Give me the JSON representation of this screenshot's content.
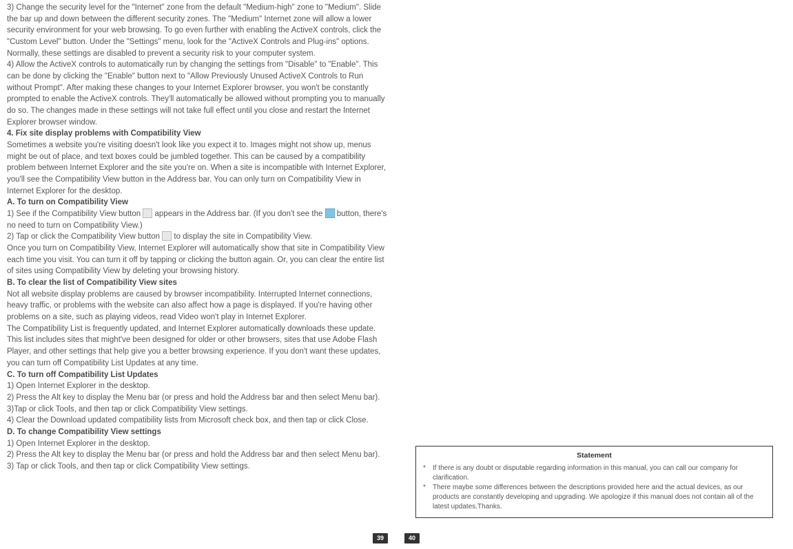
{
  "left": {
    "p3": "3) Change the security level for the \"Internet\" zone from the default \"Medium-high\" zone to \"Medium\". Slide the bar up and down between the different security zones. The \"Medium\" Internet zone will allow a lower security environment for your web browsing. To go even further with enabling the ActiveX controls, click the \"Custom Level\" button. Under the \"Settings\" menu, look for the \"ActiveX Controls and Plug-ins\" options. Normally, these settings are disabled to prevent a security risk to your computer system.",
    "p4": "4) Allow the ActiveX controls to automatically run by changing the settings from \"Disable\" to \"Enable\". This can be done by clicking the \"Enable\" button next to \"Allow Previously Unused ActiveX Controls to Run without Prompt\". After making these changes to your Internet Explorer browser, you won't be constantly prompted to enable the ActiveX controls. They'll automatically be allowed without prompting you to manually do so. The changes made in these settings will not take full effect until you close and restart the Internet Explorer browser window.",
    "h4": "4. Fix site display problems with Compatibility View",
    "p5": "Sometimes a website you're visiting doesn't look like you expect it to. Images might not show up, menus might be out of place, and text boxes could be jumbled together. This can be caused by a compatibility problem between Internet Explorer and the site you're on. When a site is incompatible with Internet Explorer, you'll see the Compatibility View button in the Address bar. You can only turn on Compatibility View in Internet Explorer for the desktop.",
    "hA": "A. To turn on Compatibility View",
    "p6a": "1) See if the Compatibility View button ",
    "p6b": " appears in the Address bar. (If you don't see the ",
    "p6c": " button, there's no need to turn on Compatibility View.)",
    "p7a": "2) Tap or click the Compatibility View button ",
    "p7b": " to display the site in Compatibility View.",
    "p8": "Once you turn on Compatibility View, Internet Explorer will automatically show that site in Compatibility View each time you visit. You can turn it off by tapping or clicking the button again. Or, you can clear the entire list of sites using Compatibility View by deleting your browsing history.",
    "hB": "B. To clear the list of Compatibility View sites",
    "p9": "Not all website display problems are caused by browser incompatibility. Interrupted Internet connections, heavy traffic, or problems with the website can also affect how a page is displayed. If you're having other problems on a site, such as playing videos, read Video won't play in Internet Explorer.",
    "p10": "The Compatibility List is frequently updated, and Internet Explorer automatically downloads these update. This list includes sites that might've been designed for older or other browsers, sites that use Adobe Flash Player, and other settings that help give you a better browsing experience. If you don't want these updates, you can turn off Compatibility List Updates at any time.",
    "hC": "C. To turn off Compatibility List Updates",
    "p11": "1) Open Internet Explorer in the desktop.",
    "p12": "2) Press the Alt key to display the Menu bar (or press and hold the Address bar and then select Menu bar).",
    "p13": "3)Tap or click Tools, and then tap or click Compatibility View settings.",
    "p14": "4) Clear the Download updated compatibility lists from Microsoft check box, and then tap or click Close.",
    "hD": "D. To change Compatibility View settings",
    "p15": "1) Open Internet Explorer in the desktop.",
    "p16": "2) Press the Alt key to display the Menu bar (or press and hold the Address bar and then select Menu bar).",
    "p17": "3) Tap or click Tools, and then tap or click Compatibility View settings.",
    "pagenum": "39"
  },
  "right": {
    "statement_title": "Statement",
    "s1": "If there is any doubt or disputable regarding information in this manual, you can call our company for clarification.",
    "s2": "There maybe some differences between the descriptions provided here and the actual devices, as our products are constantly developing and upgrading. We apologize if this manual does not contain all of the latest updates.Thanks.",
    "pagenum": "40"
  }
}
